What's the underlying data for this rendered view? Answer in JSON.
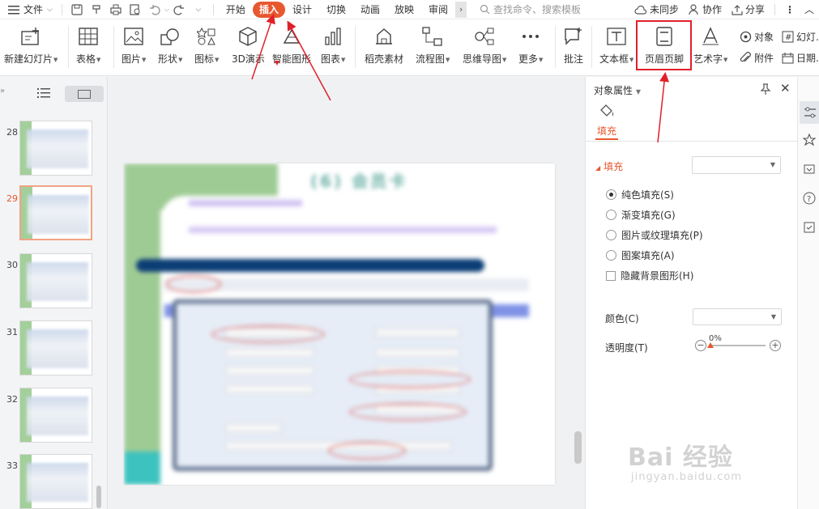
{
  "menubar": {
    "menu_label": "文件",
    "tabs": [
      "开始",
      "插入",
      "设计",
      "切换",
      "动画",
      "放映",
      "审阅"
    ],
    "active_tab": "插入",
    "search_placeholder": "查找命令、搜索模板",
    "sync_label": "未同步",
    "collab_label": "协作",
    "share_label": "分享"
  },
  "ribbon": {
    "new_slide": "新建幻灯片",
    "table": "表格",
    "picture": "图片",
    "shape": "形状",
    "icon": "图标",
    "demo3d": "3D演示",
    "smartart": "智能图形",
    "chart": "图表",
    "material": "稻壳素材",
    "flowchart": "流程图",
    "mindmap": "思维导图",
    "more": "更多",
    "comment": "批注",
    "textbox": "文本框",
    "header_footer": "页眉页脚",
    "wordart": "艺术字",
    "object": "对象",
    "attachment": "附件",
    "slide_num": "幻灯...",
    "datetime": "日期..."
  },
  "thumbnails": {
    "slides": [
      {
        "num": "28",
        "active": false
      },
      {
        "num": "29",
        "active": true
      },
      {
        "num": "30",
        "active": false
      },
      {
        "num": "31",
        "active": false
      },
      {
        "num": "32",
        "active": false
      },
      {
        "num": "33",
        "active": false
      }
    ]
  },
  "slide": {
    "title": "(6) 会员卡"
  },
  "properties": {
    "title": "对象属性",
    "tab_fill": "填充",
    "section_fill": "填充",
    "options": [
      "纯色填充(S)",
      "渐变填充(G)",
      "图片或纹理填充(P)",
      "图案填充(A)"
    ],
    "selected_option": "纯色填充(S)",
    "hide_bg": "隐藏背景图形(H)",
    "color_label": "颜色(C)",
    "transparency_label": "透明度(T)",
    "transparency_value": "0%"
  },
  "watermark": {
    "main": "Bai 经验",
    "sub": "jingyan.baidu.com"
  },
  "colors": {
    "accent": "#e8572e",
    "highlight_box": "#e0202a"
  }
}
